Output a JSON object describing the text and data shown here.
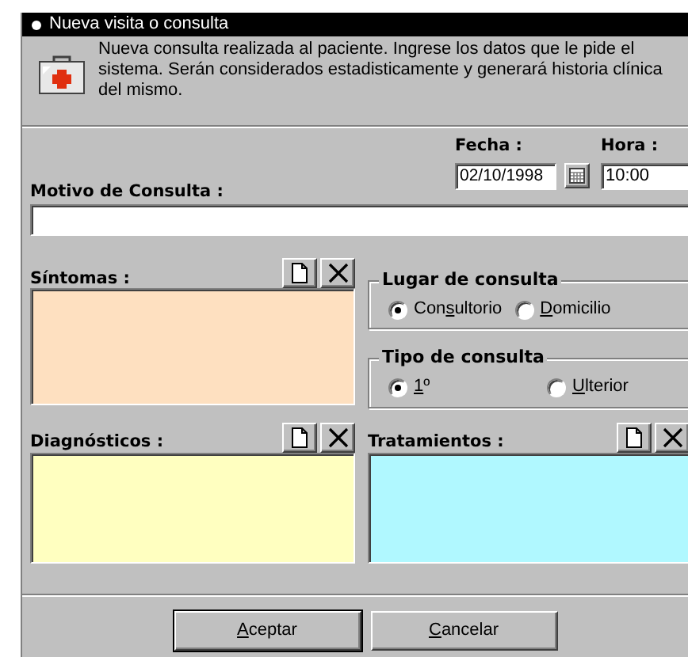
{
  "window": {
    "title": "Nueva visita o consulta"
  },
  "header": {
    "text": "Nueva consulta realizada al paciente. Ingrese los datos que le pide el sistema. Serán considerados estadisticamente y generará historia clínica del mismo."
  },
  "fecha": {
    "label": "Fecha :",
    "value": "02/10/1998"
  },
  "hora": {
    "label": "Hora :",
    "value": "10:00"
  },
  "motivo": {
    "label": "Motivo de Consulta :"
  },
  "panels": [
    {
      "label": "Síntomas :",
      "color": "#fee0c0"
    },
    {
      "label": "Diagnósticos :",
      "color": "#ffffc0"
    },
    {
      "label": "Tratamientos :",
      "color": "#b0f8ff"
    }
  ],
  "groups": [
    {
      "title": "Lugar de consulta",
      "options": [
        {
          "text_before": "Con",
          "access_key": "s",
          "text_after": "ultorio",
          "selected": true
        },
        {
          "access_key": "D",
          "text_after": "omicilio",
          "selected": false
        }
      ]
    },
    {
      "title": "Tipo de consulta",
      "options": [
        {
          "access_key": "1",
          "text_after": "º",
          "selected": true
        },
        {
          "access_key": "U",
          "text_after": "lterior",
          "selected": false
        }
      ]
    }
  ],
  "buttons": [
    {
      "access_key": "A",
      "text_after": "ceptar",
      "default": true
    },
    {
      "access_key": "C",
      "text_after": "ancelar",
      "default": false
    }
  ]
}
